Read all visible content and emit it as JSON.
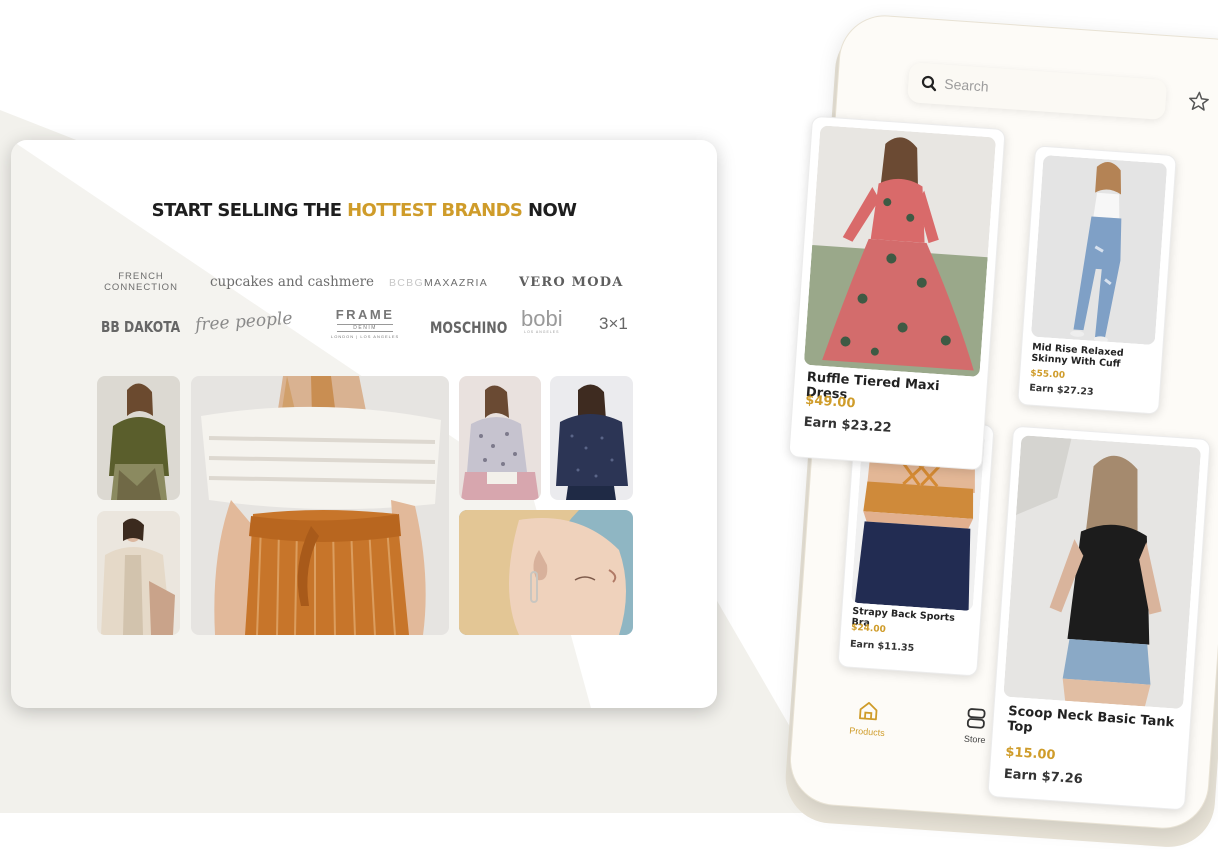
{
  "colors": {
    "accent": "#cf9c2a",
    "text": "#1e1e1e",
    "card_bg": "#f4f3ef"
  },
  "headline": {
    "part1": "START SELLING THE ",
    "accent": "HOTTEST BRANDS",
    "part2": " NOW"
  },
  "brands": {
    "french_line1": "FRENCH",
    "french_line2": "CONNECTION",
    "cupcakes": "cupcakes and cashmere",
    "bcbg_prefix": "BCBG",
    "bcbg_main": "MAXAZRIA",
    "vero_moda": "VERO MODA",
    "bb_dakota": "BB DAKOTA",
    "free_people": "free people",
    "frame_main": "FRAME",
    "frame_sub": "DENIM",
    "frame_city": "LONDON | LOS ANGELES",
    "moschino": "MOSCHINO",
    "bobi": "bobi",
    "bobi_city": "LOS ANGELES",
    "threex1": "3×1"
  },
  "phone": {
    "search_placeholder": "Search",
    "nav": {
      "products": "Products",
      "store": "Store"
    },
    "products": [
      {
        "name": "Ruffle Tiered Maxi Dress",
        "price": "$49.00",
        "earn": "Earn $23.22"
      },
      {
        "name": "Mid Rise Relaxed Skinny With Cuff",
        "price": "$55.00",
        "earn": "Earn $27.23"
      },
      {
        "name": "Strapy Back Sports Bra",
        "price": "$24.00",
        "earn": "Earn $11.35"
      },
      {
        "name": "Scoop Neck Basic Tank Top",
        "price": "$15.00",
        "earn": "Earn $7.26"
      }
    ]
  },
  "icons": [
    "search-icon",
    "star-icon",
    "home-icon",
    "store-icon"
  ]
}
